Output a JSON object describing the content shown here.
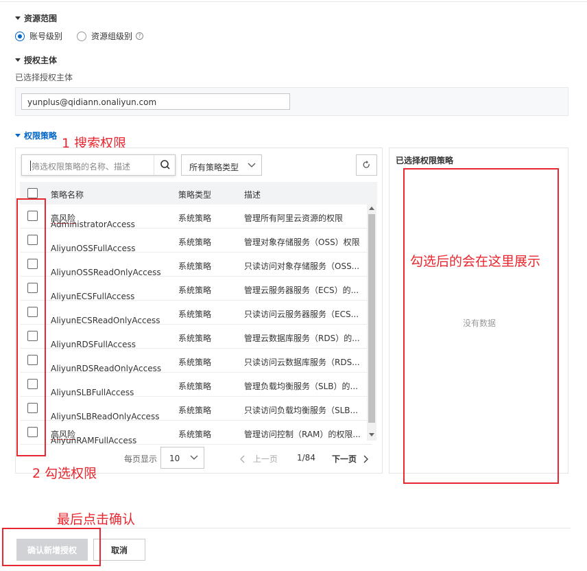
{
  "resource_scope": {
    "title": "资源范围",
    "options": [
      {
        "label": "账号级别",
        "checked": true
      },
      {
        "label": "资源组级别",
        "checked": false
      }
    ]
  },
  "principal": {
    "title": "授权主体",
    "selected_label": "已选择授权主体",
    "value": "yunplus@qidiann.onaliyun.com"
  },
  "policies": {
    "title": "权限策略",
    "search_placeholder": "筛选权限策略的名称、描述",
    "type_select": "所有策略类型",
    "columns": {
      "name": "策略名称",
      "type": "策略类型",
      "desc": "描述"
    },
    "risk_label": "高风险",
    "rows": [
      {
        "name": "AdministratorAccess",
        "type": "系统策略",
        "desc": "管理所有阿里云资源的权限"
      },
      {
        "name": "AliyunOSSFullAccess",
        "type": "系统策略",
        "desc": "管理对象存储服务（OSS）权限"
      },
      {
        "name": "AliyunOSSReadOnlyAccess",
        "type": "系统策略",
        "desc": "只读访问对象存储服务（OSS..."
      },
      {
        "name": "AliyunECSFullAccess",
        "type": "系统策略",
        "desc": "管理云服务器服务（ECS）的..."
      },
      {
        "name": "AliyunECSReadOnlyAccess",
        "type": "系统策略",
        "desc": "只读访问云服务器服务（ECS..."
      },
      {
        "name": "AliyunRDSFullAccess",
        "type": "系统策略",
        "desc": "管理云数据库服务（RDS）的..."
      },
      {
        "name": "AliyunRDSReadOnlyAccess",
        "type": "系统策略",
        "desc": "只读访问云数据库服务（RDS..."
      },
      {
        "name": "AliyunSLBFullAccess",
        "type": "系统策略",
        "desc": "管理负载均衡服务（SLB）的..."
      },
      {
        "name": "AliyunSLBReadOnlyAccess",
        "type": "系统策略",
        "desc": "只读访问负载均衡服务（SLB..."
      },
      {
        "name": "AliyunRAMFullAccess",
        "type": "系统策略",
        "desc": "管理访问控制（RAM）的权限..."
      }
    ],
    "pagination": {
      "page_size_label": "每页显示",
      "page_size": "10",
      "prev": "上一页",
      "page": "1/84",
      "next": "下一页"
    }
  },
  "selected_panel": {
    "title": "已选择权限策略",
    "empty": "没有数据"
  },
  "annotations": {
    "search": "1 搜索权限",
    "check": "2 勾选权限",
    "shown": "勾选后的会在这里展示",
    "confirm": "最后点击确认"
  },
  "footer": {
    "confirm": "确认新增授权",
    "cancel": "取消"
  },
  "colors": {
    "accent": "#0064c8",
    "annotation": "#e8262d"
  }
}
